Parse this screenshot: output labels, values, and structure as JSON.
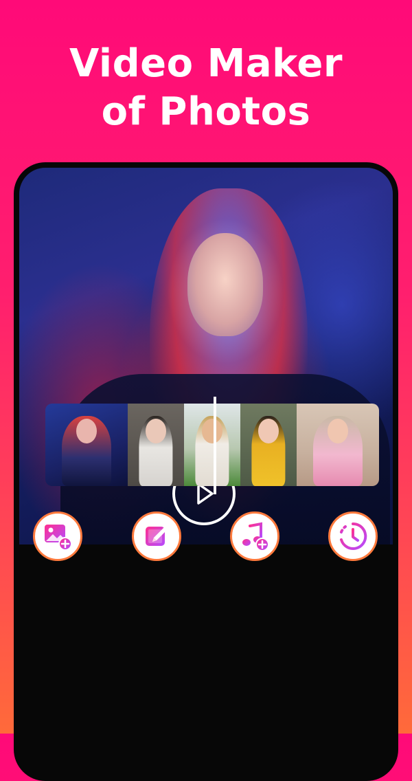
{
  "headline": {
    "line1": "Video Maker",
    "line2": "of Photos"
  },
  "preview": {
    "play_icon": "play-icon"
  },
  "timeline": {
    "thumbnails": [
      {
        "name": "thumb-neon-portrait"
      },
      {
        "name": "thumb-tree-portrait"
      },
      {
        "name": "thumb-hat-field"
      },
      {
        "name": "thumb-yellow-sweater"
      },
      {
        "name": "thumb-flowers-bike"
      }
    ]
  },
  "toolbar": {
    "icons": [
      "add-photo-icon",
      "edit-icon",
      "add-music-icon",
      "duration-icon"
    ]
  },
  "colors": {
    "accent_pink": "#ff0a78",
    "accent_orange": "#ff6a3a",
    "icon_gradient_start": "#ff2f8f",
    "icon_gradient_end": "#b44bff"
  }
}
